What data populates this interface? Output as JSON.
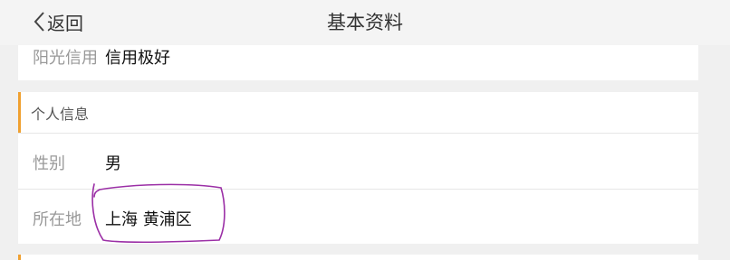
{
  "header": {
    "back_label": "返回",
    "title": "基本资料"
  },
  "top_card": {
    "label": "阳光信用",
    "value": "信用极好"
  },
  "personal_section": {
    "title": "个人信息",
    "rows": [
      {
        "label": "性别",
        "value": "男"
      },
      {
        "label": "所在地",
        "value": "上海 黄浦区"
      }
    ]
  },
  "colors": {
    "accent": "#f0a030",
    "annotation": "#9b2fa6"
  }
}
